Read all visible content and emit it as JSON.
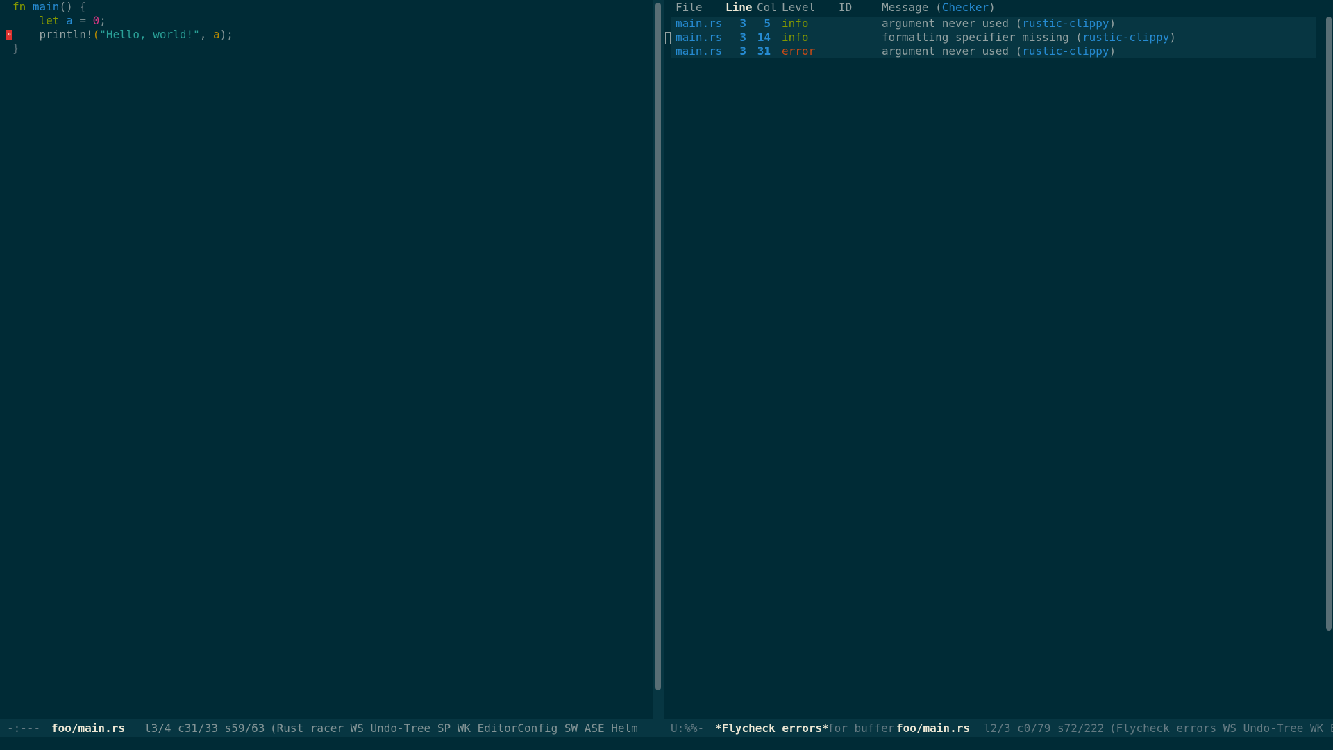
{
  "editor": {
    "lines": [
      {
        "tokens": [
          {
            "t": "fn",
            "c": "kw"
          },
          {
            "t": " ",
            "c": "punc"
          },
          {
            "t": "main",
            "c": "fn"
          },
          {
            "t": "() ",
            "c": "punc"
          },
          {
            "t": "{",
            "c": "brace"
          }
        ]
      },
      {
        "tokens": [
          {
            "t": "    ",
            "c": "punc"
          },
          {
            "t": "let",
            "c": "kw"
          },
          {
            "t": " ",
            "c": "punc"
          },
          {
            "t": "a",
            "c": "fn"
          },
          {
            "t": " = ",
            "c": "punc"
          },
          {
            "t": "0",
            "c": "num"
          },
          {
            "t": ";",
            "c": "punc"
          }
        ]
      },
      {
        "tokens": [
          {
            "t": "    ",
            "c": "punc"
          },
          {
            "t": "println!",
            "c": "mac"
          },
          {
            "t": "(",
            "c": "var"
          },
          {
            "t": "\"Hello, world!\"",
            "c": "str"
          },
          {
            "t": ", ",
            "c": "punc"
          },
          {
            "t": "a",
            "c": "var"
          },
          {
            "t": ");",
            "c": "punc"
          }
        ]
      },
      {
        "tokens": [
          {
            "t": "}",
            "c": "brace"
          }
        ]
      }
    ],
    "error_marker_line": 3,
    "error_marker_glyph": "»"
  },
  "errors": {
    "header": {
      "file": "File",
      "line": "Line",
      "col": "Col",
      "level": "Level",
      "id": "ID",
      "message": "Message (",
      "checker": "Checker",
      ")": ")"
    },
    "rows": [
      {
        "file": "main.rs",
        "line": "3",
        "col": "5",
        "level": "info",
        "level_class": "lvl-info",
        "message": "argument never used (",
        "checker": "rustic-clippy",
        "close": ")"
      },
      {
        "file": "main.rs",
        "line": "3",
        "col": "14",
        "level": "info",
        "level_class": "lvl-info",
        "message": "formatting specifier missing (",
        "checker": "rustic-clippy",
        "close": ")"
      },
      {
        "file": "main.rs",
        "line": "3",
        "col": "31",
        "level": "error",
        "level_class": "lvl-error",
        "message": "argument never used (",
        "checker": "rustic-clippy",
        "close": ")"
      }
    ]
  },
  "modeline": {
    "left_status": "-:---",
    "left_buffer": "foo/main.rs",
    "left_pos": "l3/4 c31/33 s59/63",
    "left_modes": "(Rust racer WS Undo-Tree SP WK EditorConfig SW ASE Helm GitGutt",
    "right_status": "U:%%-",
    "right_buffer": "*Flycheck errors*",
    "right_for": "for buffer",
    "right_target": "foo/main.rs",
    "right_pos": "l2/3 c0/79 s72/222",
    "right_modes": "(Flycheck errors WS Undo-Tree WK Edi"
  },
  "colors": {
    "background": "#002b36",
    "highlight": "#073642",
    "error": "#cb4b16",
    "info": "#859900",
    "link": "#268bd2"
  }
}
